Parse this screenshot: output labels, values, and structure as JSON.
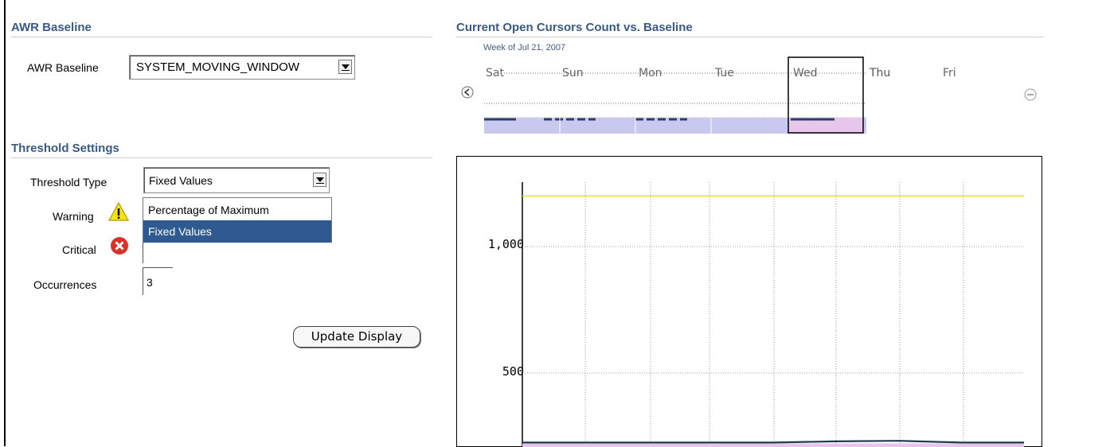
{
  "awr_baseline": {
    "section_title": "AWR Baseline",
    "label": "AWR Baseline",
    "selected_value": "SYSTEM_MOVING_WINDOW"
  },
  "threshold": {
    "section_title": "Threshold Settings",
    "type_label": "Threshold Type",
    "type_selected": "Fixed Values",
    "type_options": [
      "Percentage of Maximum",
      "Fixed Values"
    ],
    "warning_label": "Warning",
    "critical_label": "Critical",
    "occurrences_label": "Occurrences",
    "occurrences_value": "3",
    "update_button": "Update Display",
    "warning_icon": "warning-triangle-icon",
    "critical_icon": "critical-x-icon"
  },
  "overview": {
    "section_title": "Current Open Cursors Count vs. Baseline",
    "week_label": "Week of Jul 21, 2007",
    "days": [
      "Sat",
      "Sun",
      "Mon",
      "Tue",
      "Wed",
      "Thu",
      "Fri"
    ],
    "selected_day": "Wed",
    "prev_icon": "chevron-left-circle-icon",
    "next_icon": "chevron-right-circle-icon"
  },
  "chart_data": {
    "type": "line",
    "title": "",
    "xlabel": "",
    "ylabel": "",
    "yticks": [
      "1,000",
      "500"
    ],
    "ytick_values": [
      1000,
      500
    ],
    "ylim": [
      200,
      1300
    ],
    "grid": true,
    "series": [
      {
        "values": [
          1200,
          1200,
          1200,
          1200,
          1200,
          1200,
          1200,
          1200,
          1200
        ],
        "color": "#e6e63a"
      },
      {
        "values": [
          225,
          225,
          225,
          225,
          225,
          230,
          232,
          225,
          225
        ],
        "color": "#1f3a4d"
      },
      {
        "values": [
          222,
          222,
          222,
          222,
          222,
          222,
          222,
          222,
          222
        ],
        "color": "#e8c6ec"
      }
    ],
    "colors": {
      "threshold": "#e6e63a",
      "current": "#1f3a4d",
      "baseline_band": "#e8c6ec"
    }
  }
}
